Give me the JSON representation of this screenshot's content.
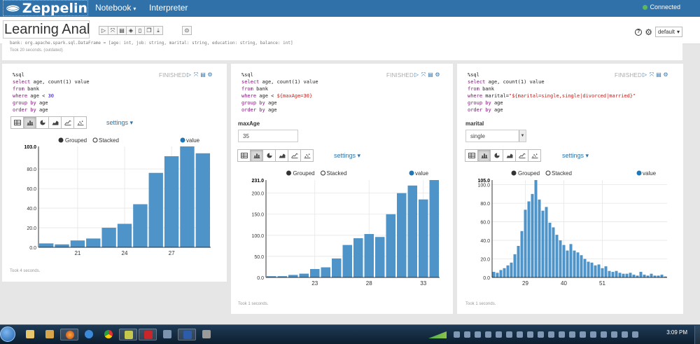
{
  "app": {
    "brand": "Zeppelin",
    "connection_status": "Connected"
  },
  "nav": [
    {
      "label": "Notebook",
      "has_caret": true
    },
    {
      "label": "Interpreter",
      "has_caret": false
    }
  ],
  "notebook": {
    "title": "Learning Analyt",
    "interpreter_binding": "default"
  },
  "previous_paragraph": {
    "code": "bank: org.apache.spark.sql.DataFrame = [age: int, job: string, marital: string, education: string, balance: int]",
    "took": "Took 20 seconds. (outdated)"
  },
  "viz_modes": [
    "table",
    "bar",
    "pie",
    "area",
    "line",
    "scatter"
  ],
  "icons": {
    "run": "play-icon",
    "hide": "expand-icon",
    "output": "book-icon",
    "clear": "eraser-icon",
    "delete": "trash-icon",
    "clone": "clone-icon",
    "export": "download-icon",
    "keyboard": "info-icon",
    "help": "help-icon",
    "settings": "gear-icon"
  },
  "paragraphs": [
    {
      "status": "FINISHED",
      "code": [
        "%sql",
        "select age, count(1) value",
        "from bank",
        "where age < 30",
        "group by age",
        "order by age"
      ],
      "form": null,
      "settings_label": "settings",
      "legend": {
        "grouped": "Grouped",
        "stacked": "Stacked",
        "series": "value"
      },
      "took": "Took 4 seconds."
    },
    {
      "status": "FINISHED",
      "code": [
        "%sql",
        "select age, count(1) value",
        "from bank",
        "where age < ${maxAge=30}",
        "group by age",
        "order by age"
      ],
      "form": {
        "label": "maxAge",
        "value": "35",
        "type": "input"
      },
      "settings_label": "settings",
      "legend": {
        "grouped": "Grouped",
        "stacked": "Stacked",
        "series": "value"
      },
      "took": "Took 1 seconds."
    },
    {
      "status": "FINISHED",
      "code": [
        "%sql",
        "select age, count(1) value",
        "from bank",
        "where marital=\"${marital=single,single|divorced|married}\"",
        "group by age",
        "order by age"
      ],
      "form": {
        "label": "marital",
        "value": "single",
        "type": "select"
      },
      "settings_label": "settings",
      "legend": {
        "grouped": "Grouped",
        "stacked": "Stacked",
        "series": "value"
      },
      "took": "Took 1 seconds."
    }
  ],
  "chart_data": [
    {
      "type": "bar",
      "series": [
        {
          "name": "value",
          "x": [
            19,
            20,
            21,
            22,
            23,
            24,
            25,
            26,
            27,
            28,
            29
          ],
          "values": [
            4,
            3,
            7,
            9,
            20,
            24,
            44,
            76,
            93,
            103,
            96
          ]
        }
      ],
      "xticks": [
        21,
        24,
        27
      ],
      "yticks": [
        0,
        20,
        40,
        60,
        80
      ],
      "ymax_label": "103.0",
      "ylim": [
        0,
        103
      ],
      "color": "#4f94c8"
    },
    {
      "type": "bar",
      "series": [
        {
          "name": "value",
          "x": [
            19,
            20,
            21,
            22,
            23,
            24,
            25,
            26,
            27,
            28,
            29,
            30,
            31,
            32,
            33,
            34
          ],
          "values": [
            3,
            3,
            6,
            9,
            20,
            24,
            45,
            77,
            93,
            103,
            96,
            150,
            200,
            218,
            185,
            231
          ]
        }
      ],
      "xticks": [
        23,
        28,
        33
      ],
      "yticks": [
        0,
        50,
        100,
        150,
        200
      ],
      "ymax_label": "231.0",
      "ylim": [
        0,
        231
      ],
      "color": "#4f94c8"
    },
    {
      "type": "bar",
      "series": [
        {
          "name": "value",
          "x": [
            20,
            21,
            22,
            23,
            24,
            25,
            26,
            27,
            28,
            29,
            30,
            31,
            32,
            33,
            34,
            35,
            36,
            37,
            38,
            39,
            40,
            41,
            42,
            43,
            44,
            45,
            46,
            47,
            48,
            49,
            50,
            51,
            52,
            53,
            54,
            55,
            56,
            57,
            58,
            59,
            60,
            61,
            62,
            63,
            64,
            65,
            66,
            67,
            68,
            69
          ],
          "values": [
            6,
            5,
            8,
            10,
            13,
            16,
            25,
            34,
            50,
            73,
            82,
            90,
            105,
            84,
            72,
            76,
            59,
            54,
            46,
            40,
            35,
            29,
            36,
            29,
            27,
            24,
            20,
            17,
            16,
            13,
            14,
            10,
            12,
            7,
            6,
            7,
            5,
            4,
            4,
            5,
            3,
            2,
            6,
            3,
            2,
            4,
            2,
            2,
            3,
            1
          ]
        }
      ],
      "xticks": [
        29,
        40,
        51
      ],
      "yticks": [
        0,
        20,
        40,
        60,
        80,
        100
      ],
      "ymax_label": "105.0",
      "ylim": [
        0,
        105
      ],
      "color": "#4f94c8"
    }
  ],
  "taskbar": {
    "clock": "3:09 PM"
  }
}
